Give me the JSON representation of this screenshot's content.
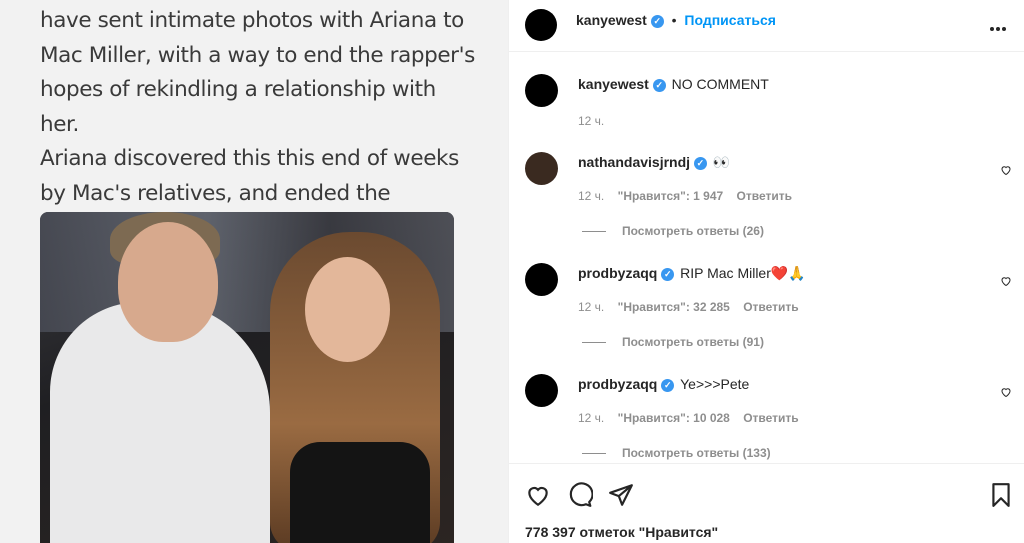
{
  "post": {
    "tweet_text": "have sent intimate photos with Ariana to\nMac Miller, with a way to end the rapper's\nhopes of rekindling a relationship with her.\nAriana discovered this this end of weeks\nby Mac's relatives, and ended the\nrelationship"
  },
  "header": {
    "username": "kanyewest",
    "separator": "•",
    "follow_label": "Подписаться"
  },
  "caption": {
    "username": "kanyewest",
    "text": "NO COMMENT",
    "time": "12 ч."
  },
  "comments": [
    {
      "username": "nathandavisjrndj",
      "text": "👀",
      "time": "12 ч.",
      "likes": "\"Нравится\": 1 947",
      "reply": "Ответить",
      "view_replies": "Посмотреть ответы (26)"
    },
    {
      "username": "prodbyzaqq",
      "text": "RIP Mac Miller❤️🙏",
      "time": "12 ч.",
      "likes": "\"Нравится\": 32 285",
      "reply": "Ответить",
      "view_replies": "Посмотреть ответы (91)"
    },
    {
      "username": "prodbyzaqq",
      "text": "Ye>>>Pete",
      "time": "12 ч.",
      "likes": "\"Нравится\": 10 028",
      "reply": "Ответить",
      "view_replies": "Посмотреть ответы (133)"
    }
  ],
  "footer": {
    "likes_count": "778 397 отметок \"Нравится\""
  },
  "icons": {
    "verified": "verified-badge-icon",
    "more": "more-options-icon",
    "heart": "heart-icon",
    "comment": "comment-icon",
    "share": "share-icon",
    "save": "bookmark-icon"
  },
  "colors": {
    "accent": "#0095f6",
    "verified": "#3897f0",
    "muted": "#8e8e8e"
  }
}
